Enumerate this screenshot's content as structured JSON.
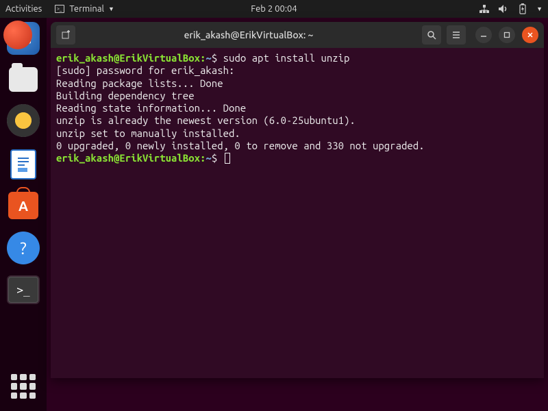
{
  "topbar": {
    "activities": "Activities",
    "app_name": "Terminal",
    "clock": "Feb 2  00:04"
  },
  "window": {
    "title": "erik_akash@ErikVirtualBox: ~"
  },
  "terminal": {
    "prompt_user_host": "erik_akash@ErikVirtualBox",
    "prompt_path": "~",
    "prompt_symbol": "$",
    "command1": "sudo apt install unzip",
    "lines": [
      "[sudo] password for erik_akash:",
      "Reading package lists... Done",
      "Building dependency tree",
      "Reading state information... Done",
      "unzip is already the newest version (6.0-25ubuntu1).",
      "unzip set to manually installed.",
      "0 upgraded, 0 newly installed, 0 to remove and 330 not upgraded."
    ]
  },
  "dock": {
    "items": [
      "thunderbird",
      "files",
      "rhythmbox",
      "writer",
      "software",
      "help",
      "terminal"
    ]
  }
}
